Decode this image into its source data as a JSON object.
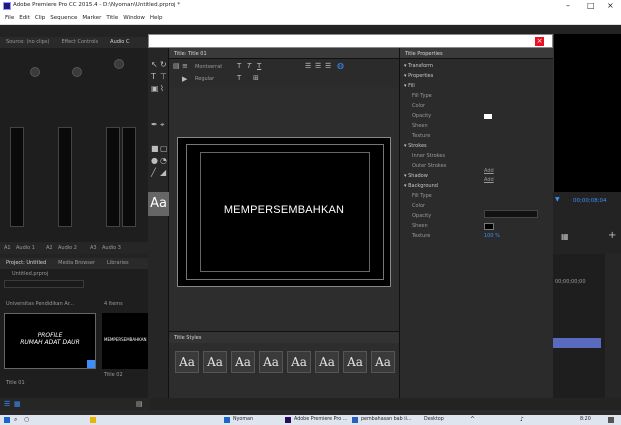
{
  "window": {
    "title": "Adobe Premiere Pro CC 2015.4 - D:\\Nyoman\\Untitled.prproj *"
  },
  "menu": [
    "File",
    "Edit",
    "Clip",
    "Sequence",
    "Marker",
    "Title",
    "Window",
    "Help"
  ],
  "audio_panel": {
    "tabs": [
      "Source: (no clips)",
      "Effect Controls",
      "Audio C"
    ],
    "tracks": [
      "A1",
      "Audio 1",
      "A2",
      "Audio 2",
      "A3",
      "Audio 3"
    ]
  },
  "title_panel": {
    "tab": "Title: Title 01",
    "canvas_text": "MEMPERSEMBAHKAN",
    "font_name": "Montserrat",
    "font_style": "Regular",
    "toolbar_glyph": "Aa",
    "styles_tab": "Title Styles",
    "style_glyph": "Aa",
    "styles_count": 8
  },
  "title_properties": {
    "tab": "Title Properties",
    "items": [
      {
        "label": "Transform",
        "header": true
      },
      {
        "label": "Properties",
        "header": true
      },
      {
        "label": "Fill",
        "header": true
      },
      {
        "label": "Fill Type",
        "header": false
      },
      {
        "label": "Color",
        "header": false
      },
      {
        "label": "Opacity",
        "header": false
      },
      {
        "label": "Sheen",
        "header": false
      },
      {
        "label": "Texture",
        "header": false
      },
      {
        "label": "Strokes",
        "header": true
      },
      {
        "label": "Inner Strokes",
        "header": false
      },
      {
        "label": "Outer Strokes",
        "header": false
      },
      {
        "label": "Shadow",
        "header": true
      },
      {
        "label": "Background",
        "header": true
      },
      {
        "label": "Fill Type",
        "header": false
      },
      {
        "label": "Color",
        "header": false
      },
      {
        "label": "Opacity",
        "header": false
      },
      {
        "label": "Sheen",
        "header": false
      },
      {
        "label": "Texture",
        "header": false
      }
    ],
    "add_label": "Add",
    "opacity_value": "100 %"
  },
  "project_panel": {
    "tabs": [
      "Project: Untitled",
      "Media Browser",
      "Libraries"
    ],
    "project_file": "Untitled.prproj",
    "bin_name": "Universitas Pendidikan Ar...",
    "bin_count": "4 Items",
    "clip1_caption": "Title 02",
    "clip1_text": "PROFILE\nRUMAH ADAT DAUR",
    "clip2_caption": "Title 01",
    "clip2_text": "MEMPERSEMBAHKAN",
    "bottom_caption": "Title 01"
  },
  "program_monitor": {
    "timecode": "00;00;08;04"
  },
  "timeline": {
    "timecode": "00;00;00;00"
  },
  "taskbar": {
    "apps": [
      "Nyoman",
      "Adobe Premiere Pro ...",
      "pembahasan bab ii...",
      "Desktop"
    ],
    "time": "8:20"
  },
  "colors": {
    "accent": "#3a8fff",
    "close": "#e81123",
    "panel": "#1e1e1e"
  }
}
